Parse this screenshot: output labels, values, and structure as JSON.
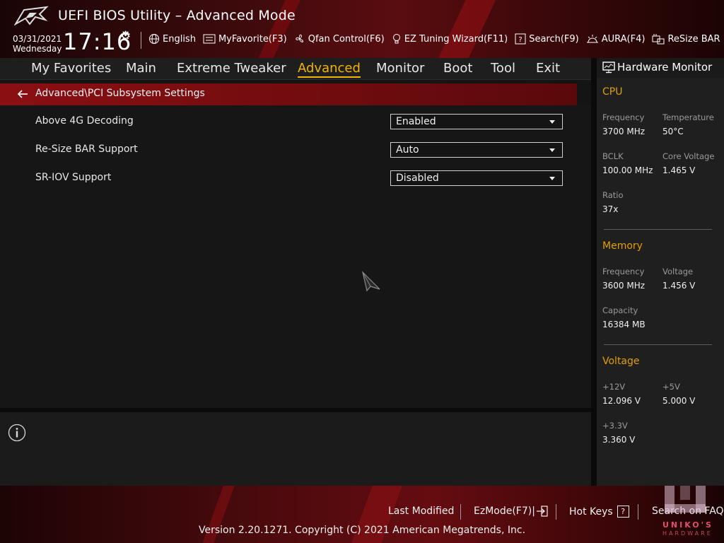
{
  "header": {
    "title": "UEFI BIOS Utility – Advanced Mode",
    "date": "03/31/2021",
    "day": "Wednesday",
    "time": "17:16",
    "toolbar": [
      {
        "label": "English",
        "icon": "globe-icon"
      },
      {
        "label": "MyFavorite(F3)",
        "icon": "favorite-icon"
      },
      {
        "label": "Qfan Control(F6)",
        "icon": "fan-icon"
      },
      {
        "label": "EZ Tuning Wizard(F11)",
        "icon": "lightbulb-icon"
      },
      {
        "label": "Search(F9)",
        "icon": "question-icon"
      },
      {
        "label": "AURA(F4)",
        "icon": "aura-icon"
      },
      {
        "label": "ReSize BAR",
        "icon": "resize-bar-icon"
      }
    ]
  },
  "tabs": [
    {
      "label": "My Favorites",
      "active": false
    },
    {
      "label": "Main",
      "active": false
    },
    {
      "label": "Extreme Tweaker",
      "active": false
    },
    {
      "label": "Advanced",
      "active": true
    },
    {
      "label": "Monitor",
      "active": false
    },
    {
      "label": "Boot",
      "active": false
    },
    {
      "label": "Tool",
      "active": false
    },
    {
      "label": "Exit",
      "active": false
    }
  ],
  "breadcrumb": "Advanced\\PCI Subsystem Settings",
  "settings": [
    {
      "label": "Above 4G Decoding",
      "value": "Enabled"
    },
    {
      "label": "Re-Size BAR Support",
      "value": "Auto"
    },
    {
      "label": "SR-IOV Support",
      "value": "Disabled"
    }
  ],
  "hardware_monitor": {
    "title": "Hardware Monitor",
    "cpu": {
      "heading": "CPU",
      "frequency_label": "Frequency",
      "frequency": "3700 MHz",
      "temperature_label": "Temperature",
      "temperature": "50°C",
      "bclk_label": "BCLK",
      "bclk": "100.00 MHz",
      "core_voltage_label": "Core Voltage",
      "core_voltage": "1.465 V",
      "ratio_label": "Ratio",
      "ratio": "37x"
    },
    "memory": {
      "heading": "Memory",
      "frequency_label": "Frequency",
      "frequency": "3600 MHz",
      "voltage_label": "Voltage",
      "voltage": "1.456 V",
      "capacity_label": "Capacity",
      "capacity": "16384 MB"
    },
    "voltage": {
      "heading": "Voltage",
      "v12_label": "+12V",
      "v12": "12.096 V",
      "v5_label": "+5V",
      "v5": "5.000 V",
      "v33_label": "+3.3V",
      "v33": "3.360 V"
    }
  },
  "footer": {
    "last_modified": "Last Modified",
    "ezmode": "EzMode(F7)|",
    "hot_keys": "Hot Keys",
    "search_faq": "Search on FAQ",
    "copyright": "Version 2.20.1271. Copyright (C) 2021 American Megatrends, Inc.",
    "watermark_text": "UNIKO'S",
    "watermark_sub": "HARDWARE"
  },
  "colors": {
    "accent": "#f4b400",
    "section": "#e0a000",
    "breadcrumb_bg": "#8a0f12"
  }
}
